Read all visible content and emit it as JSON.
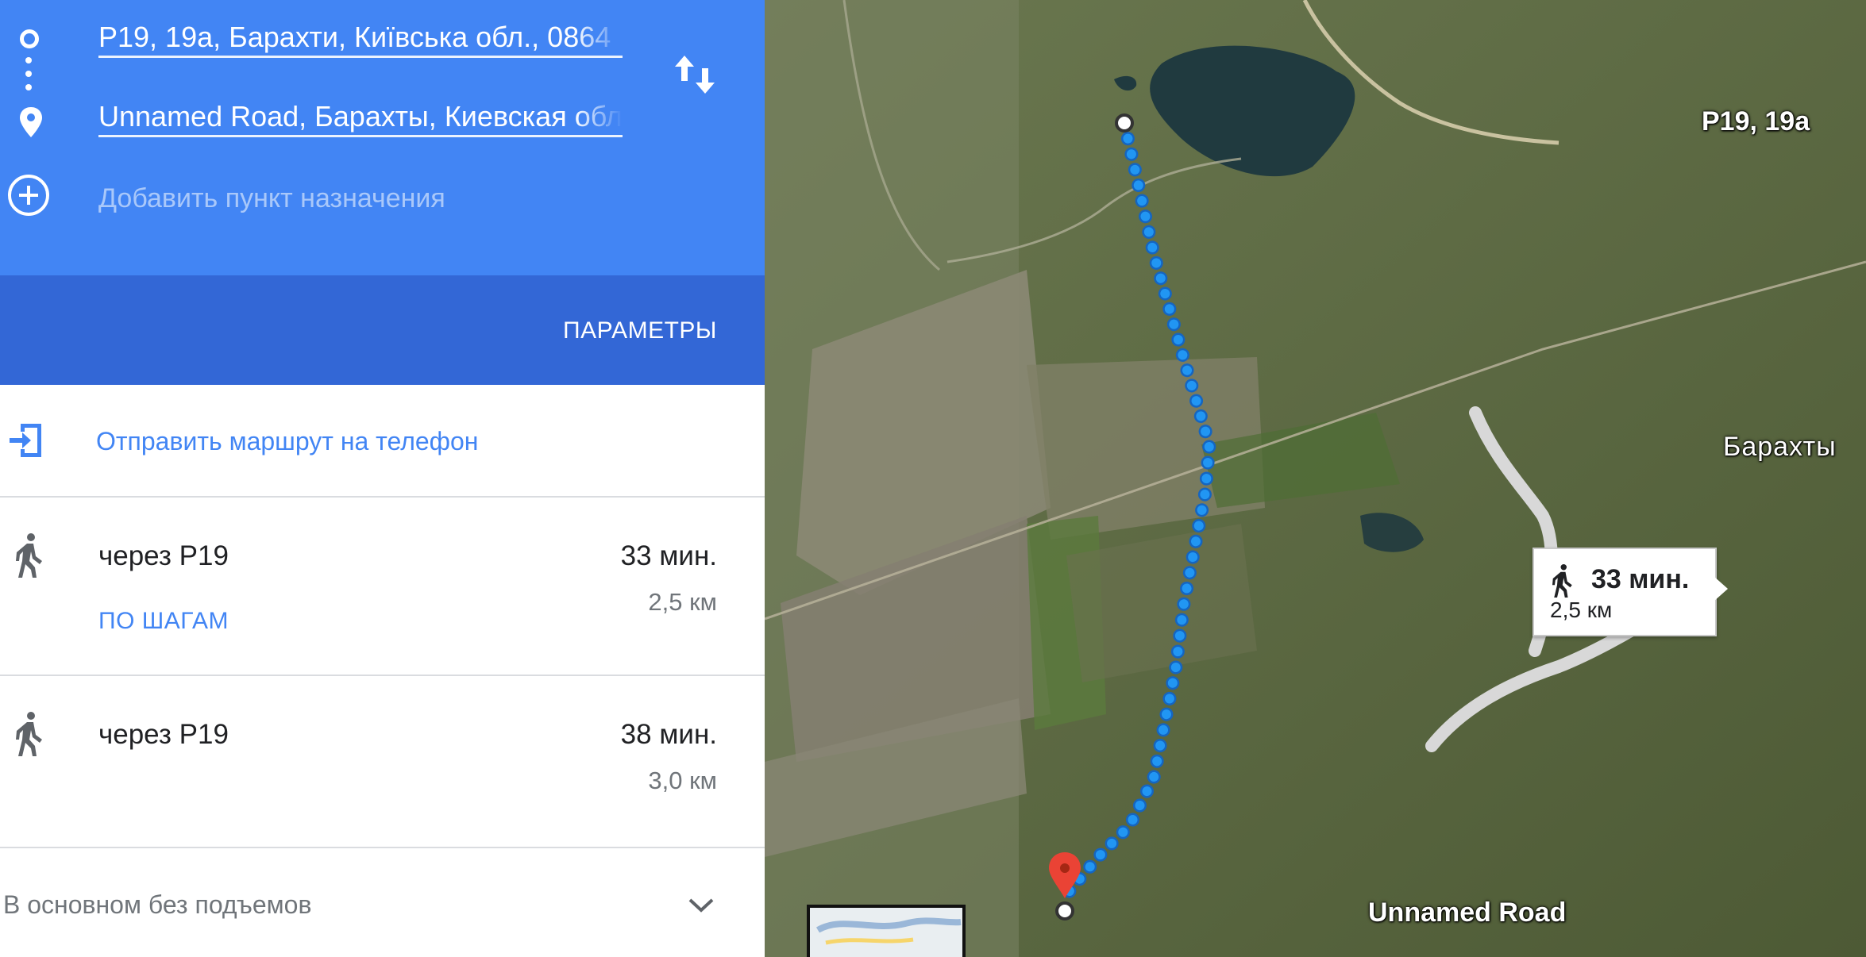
{
  "directions": {
    "origin_value": "P19, 19a, Барахти, Київська обл., 0864",
    "destination_value": "Unnamed Road, Барахты, Киевская обл",
    "add_destination_placeholder": "Добавить пункт назначения",
    "params_label": "ПАРАМЕТРЫ",
    "send_to_phone_label": "Отправить маршрут на телефон"
  },
  "routes": [
    {
      "via": "через Р19",
      "time": "33 мин.",
      "distance": "2,5 км",
      "steps_label": "ПО ШАГАМ"
    },
    {
      "via": "через Р19",
      "time": "38 мин.",
      "distance": "3,0 км"
    }
  ],
  "elevation": {
    "label": "В основном без подъемов"
  },
  "map": {
    "card": {
      "time": "33 мин.",
      "distance": "2,5 км"
    },
    "labels": {
      "start": "P19, 19a",
      "end": "Unnamed Road",
      "town": "Барахты"
    },
    "colors": {
      "route": "#2196f3",
      "panel_header": "#4285f4",
      "params_bar": "#3367d6",
      "pin": "#ea4335"
    }
  },
  "icons": [
    "origin-circle-icon",
    "route-dots-icon",
    "destination-pin-icon",
    "add-circle-icon",
    "swap-arrows-icon",
    "send-to-phone-icon",
    "walk-icon",
    "chevron-down-icon"
  ]
}
